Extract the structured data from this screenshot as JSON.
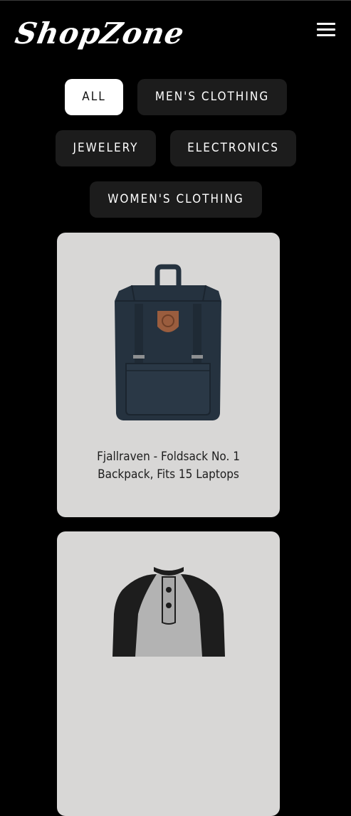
{
  "header": {
    "logo": "ShopZone",
    "menu_icon": "hamburger-menu-icon"
  },
  "filters": {
    "items": [
      {
        "label": "All",
        "active": true
      },
      {
        "label": "men's clothing",
        "active": false
      },
      {
        "label": "jewelery",
        "active": false
      },
      {
        "label": "electronics",
        "active": false
      },
      {
        "label": "women's clothing",
        "active": false
      }
    ]
  },
  "products": [
    {
      "title": "Fjallraven - Foldsack No. 1 Backpack, Fits 15 Laptops",
      "image_icon": "backpack-image"
    },
    {
      "title": "",
      "image_icon": "raglan-shirt-image"
    }
  ],
  "colors": {
    "background": "#000000",
    "button_bg": "#1c1c1c",
    "active_button_bg": "#ffffff",
    "card_bg": "#d8d7d6",
    "backpack": "#25323f",
    "patch": "#9a5d3e"
  }
}
